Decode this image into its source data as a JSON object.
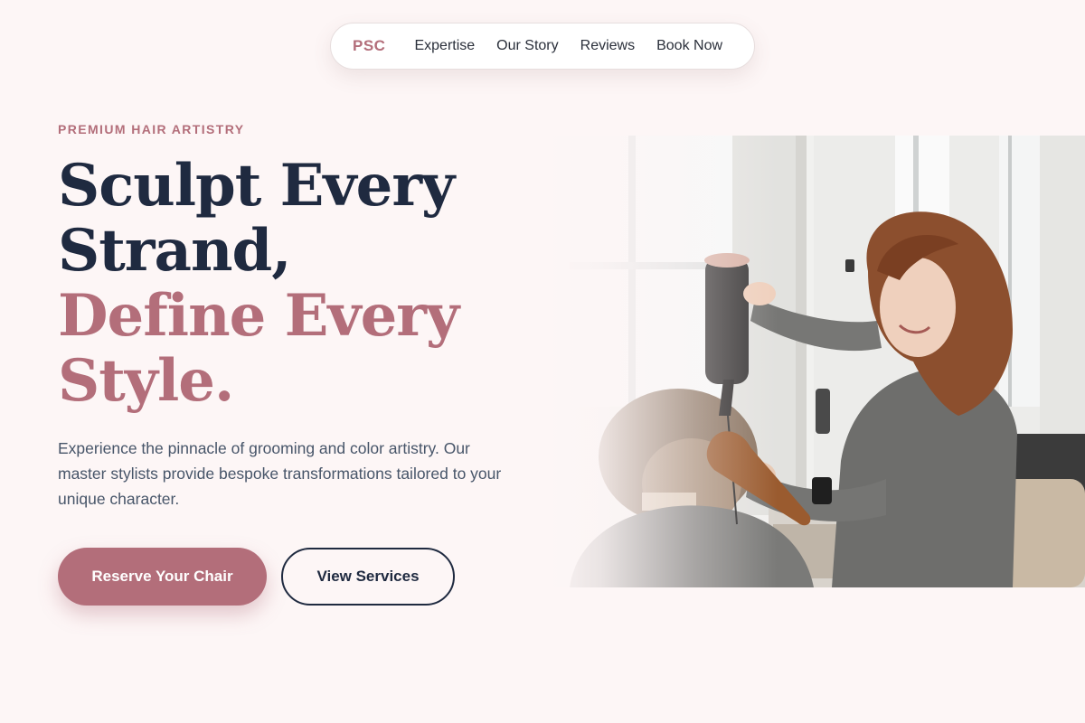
{
  "nav": {
    "logo": "PSC",
    "links": [
      "Expertise",
      "Our Story",
      "Reviews",
      "Book Now"
    ]
  },
  "hero": {
    "eyebrow": "PREMIUM HAIR ARTISTRY",
    "headline_line1": "Sculpt Every",
    "headline_line2": "Strand,",
    "headline_accent1": "Define Every",
    "headline_accent2": "Style.",
    "lead": "Experience the pinnacle of grooming and color artistry. Our master stylists provide bespoke transformations tailored to your unique character.",
    "primary_cta": "Reserve Your Chair",
    "secondary_cta": "View Services"
  },
  "colors": {
    "accent": "#b36e7a",
    "navy": "#1f2a40",
    "background": "#fdf6f6"
  }
}
